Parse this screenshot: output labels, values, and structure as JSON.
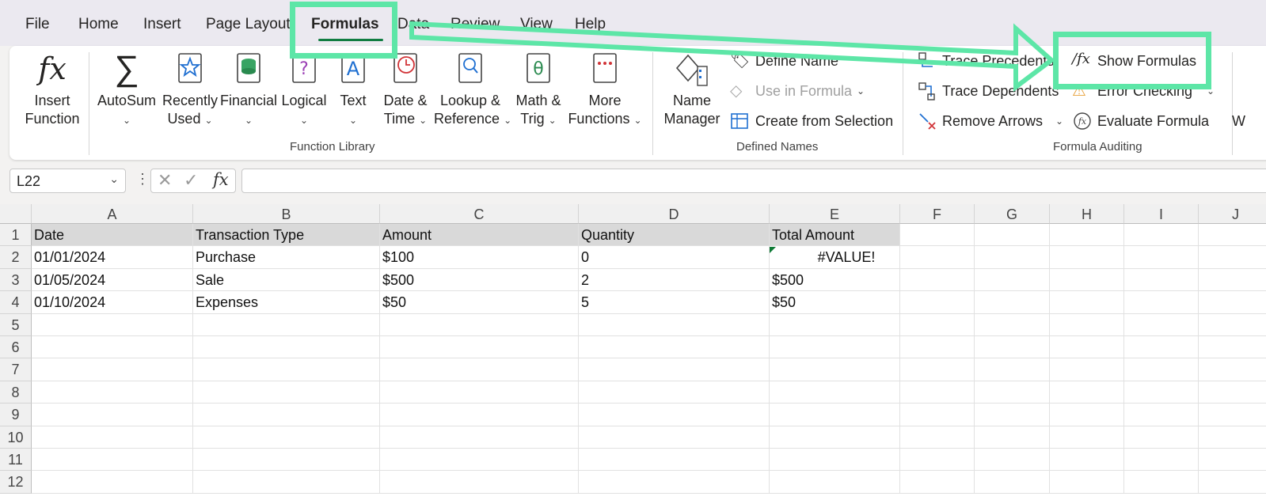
{
  "menu": {
    "tabs": [
      "File",
      "Home",
      "Insert",
      "Page Layout",
      "Formulas",
      "Data",
      "Review",
      "View",
      "Help"
    ],
    "active_tab": "Formulas"
  },
  "ribbon": {
    "function_library": {
      "label": "Function Library",
      "insert_function": [
        "Insert",
        "Function"
      ],
      "autosum": "AutoSum",
      "recently_used": [
        "Recently",
        "Used"
      ],
      "financial": "Financial",
      "logical": "Logical",
      "text": "Text",
      "date_time": [
        "Date &",
        "Time"
      ],
      "lookup": [
        "Lookup &",
        "Reference"
      ],
      "math": [
        "Math &",
        "Trig"
      ],
      "more": [
        "More",
        "Functions"
      ]
    },
    "defined_names": {
      "label": "Defined Names",
      "name_manager": [
        "Name",
        "Manager"
      ],
      "define_name": "Define Name",
      "use_in_formula": "Use in Formula",
      "create_from_selection": "Create from Selection"
    },
    "formula_auditing": {
      "label": "Formula Auditing",
      "trace_precedents": "Trace Precedents",
      "trace_dependents": "Trace Dependents",
      "remove_arrows": "Remove Arrows",
      "show_formulas": "Show Formulas",
      "error_checking": "Error Checking",
      "evaluate_formula": "Evaluate Formula"
    },
    "cut_off_label": "W"
  },
  "formula_bar": {
    "name_box": "L22",
    "formula": ""
  },
  "sheet": {
    "columns": [
      "A",
      "B",
      "C",
      "D",
      "E",
      "F",
      "G",
      "H",
      "I",
      "J"
    ],
    "rows": [
      "1",
      "2",
      "3",
      "4",
      "5",
      "6",
      "7",
      "8",
      "9",
      "10",
      "11",
      "12"
    ],
    "data": [
      [
        "Date",
        "Transaction Type",
        "Amount",
        "Quantity",
        "Total Amount"
      ],
      [
        "01/01/2024",
        "Purchase",
        "$100",
        "0",
        "#VALUE!"
      ],
      [
        "01/05/2024",
        "Sale",
        "$500",
        "2",
        "$500"
      ],
      [
        "01/10/2024",
        "Expenses",
        "$50",
        "5",
        "$50"
      ]
    ]
  },
  "colors": {
    "highlight": "#5de6a7",
    "header_fill": "#d9d9d9",
    "error_indicator": "#0e7a35"
  }
}
